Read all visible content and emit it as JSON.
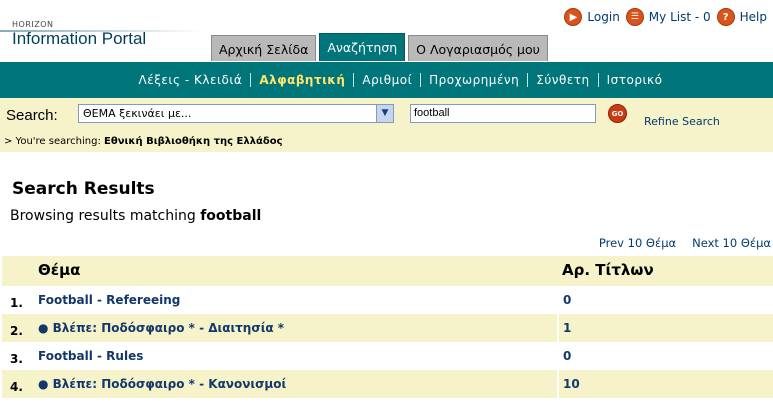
{
  "header": {
    "logo_small": "HORIZON",
    "logo_big": "Information Portal",
    "login": "Login",
    "mylist": "My List - 0",
    "help": "Help"
  },
  "tabs": [
    {
      "label": "Αρχική Σελίδα",
      "active": false
    },
    {
      "label": "Αναζήτηση",
      "active": true
    },
    {
      "label": "Ο Λογαριασμός μου",
      "active": false
    }
  ],
  "nav": [
    {
      "label": "Λέξεις - Κλειδιά",
      "active": false
    },
    {
      "label": "Αλφαβητική",
      "active": true
    },
    {
      "label": "Αριθμοί",
      "active": false
    },
    {
      "label": "Προχωρημένη",
      "active": false
    },
    {
      "label": "Σύνθετη",
      "active": false
    },
    {
      "label": "Ιστορικό",
      "active": false
    }
  ],
  "search": {
    "label": "Search:",
    "select_value": "ΘΕΜΑ ξεκινάει με...",
    "query": "football",
    "go_label": "GO",
    "refine": "Refine Search",
    "searching_prefix": "> You're searching:",
    "searching_library": "Εθνική Βιβλιοθήκη της Ελλάδος"
  },
  "results": {
    "title": "Search Results",
    "browsing_prefix": "Browsing results matching",
    "browsing_term": "football",
    "prev": "Prev 10 Θέμα",
    "next": "Next 10 Θέμα",
    "col_subject": "Θέμα",
    "col_count": "Αρ. Τίτλων",
    "rows": [
      {
        "num": "1.",
        "subject": "Football - Refereeing",
        "count": "0"
      },
      {
        "num": "2.",
        "subject": "● Βλέπε: Ποδόσφαιρο * - Διαιτησία *",
        "count": "1"
      },
      {
        "num": "3.",
        "subject": "Football - Rules",
        "count": "0"
      },
      {
        "num": "4.",
        "subject": "● Βλέπε: Ποδόσφαιρο * - Κανονισμοί",
        "count": "10"
      }
    ]
  },
  "colors": {
    "teal": "#00757a",
    "cream": "#f6f2c9",
    "link": "#13386b",
    "active_nav": "#ffe46a"
  }
}
